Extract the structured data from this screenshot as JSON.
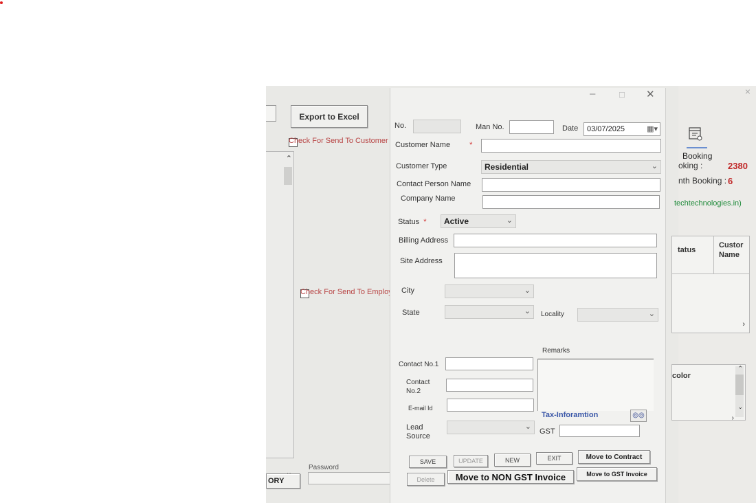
{
  "left": {
    "export_button": "Export to Excel",
    "check_customer": "Check For Send To Customer",
    "check_employee": "Check For Send To Employee",
    "password_label": "Password",
    "factory_button": "ORY"
  },
  "booking": {
    "title": "Booking",
    "stat1_label": "oking :",
    "stat1_value": "2380",
    "stat2_label": "nth Booking :",
    "stat2_value": "6",
    "site_link": "techtechnologies.in)",
    "grid_header_status": "tatus",
    "grid_header_customer": "Custor Name",
    "grid2_header": "color"
  },
  "form": {
    "no_label": "No.",
    "man_no_label": "Man No.",
    "date_label": "Date",
    "date_value": "03/07/2025",
    "customer_name_label": "Customer Name",
    "required_mark": "*",
    "customer_type_label": "Customer Type",
    "customer_type_value": "Residential",
    "contact_person_label": "Contact Person Name",
    "company_name_label": "Company Name",
    "status_label": "Status",
    "status_value": "Active",
    "billing_address_label": "Billing Address",
    "site_address_label": "Site Address",
    "city_label": "City",
    "state_label": "State",
    "locality_label": "Locality",
    "remarks_label": "Remarks",
    "contact1_label": "Contact No.1",
    "contact2_label": "Contact No.2",
    "email_label": "E-mail Id",
    "lead_source_label": "Lead Source",
    "tax_info_label": "Tax-Inforamtion",
    "gst_label": "GST"
  },
  "buttons": {
    "save": "SAVE",
    "update": "UPDATE",
    "new": "NEW",
    "exit": "EXIT",
    "move_contract": "Move to Contract",
    "delete": "Delete",
    "move_non_gst": "Move to NON GST Invoice",
    "move_gst": "Move to GST Invoice"
  },
  "colors": {
    "accent_label": "#b84545",
    "required": "#d23030",
    "stat_value": "#c02828",
    "link": "#1f8a3a",
    "tax_info": "#3a57a8"
  },
  "icons": {
    "booking": "calendar-icon",
    "date_picker": "calendar-dropdown-icon",
    "search": "binoculars-icon"
  }
}
